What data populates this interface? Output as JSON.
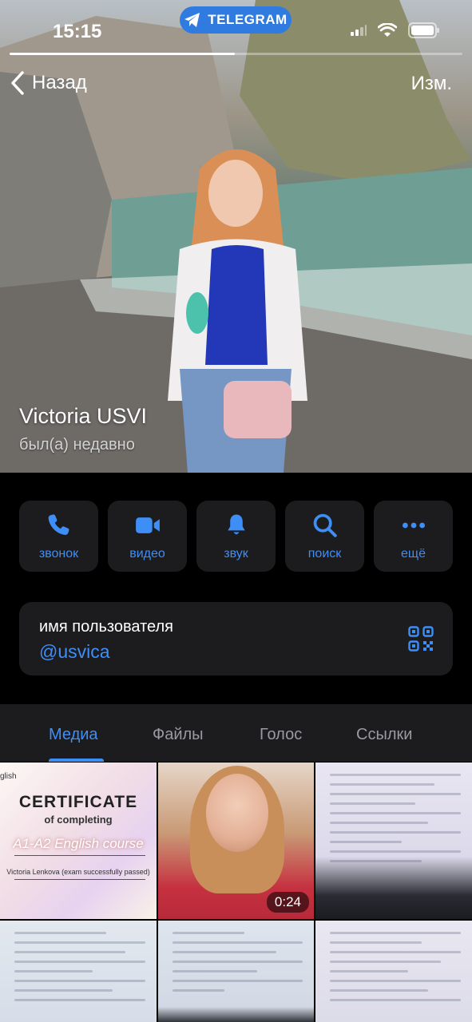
{
  "status_bar": {
    "time": "15:15",
    "telegram_pill": "TELEGRAM"
  },
  "nav": {
    "back_label": "Назад",
    "edit_label": "Изм."
  },
  "profile": {
    "name": "Victoria USVI",
    "last_seen": "был(а) недавно"
  },
  "actions": [
    {
      "label": "звонок",
      "icon": "phone-icon"
    },
    {
      "label": "видео",
      "icon": "video-camera-icon"
    },
    {
      "label": "звук",
      "icon": "bell-icon"
    },
    {
      "label": "поиск",
      "icon": "search-icon"
    },
    {
      "label": "ещё",
      "icon": "more-dots-icon"
    }
  ],
  "username": {
    "label": "имя пользователя",
    "value": "@usvica",
    "icon": "qr-code-icon"
  },
  "tabs": [
    {
      "label": "Медиа",
      "active": true
    },
    {
      "label": "Файлы",
      "active": false
    },
    {
      "label": "Голос",
      "active": false
    },
    {
      "label": "Ссылки",
      "active": false
    }
  ],
  "media": {
    "certificate": {
      "corner_text": "glish",
      "title": "CERTIFICATE",
      "subtitle": "of completing",
      "course": "A1-A2 English course",
      "recipient": "Victoria Lenkova (exam successfully passed)"
    },
    "video_duration": "0:24"
  },
  "colors": {
    "accent": "#3e8ef7",
    "card": "#1c1c1e",
    "background": "#000000",
    "telegram_pill": "#2f7be0"
  }
}
